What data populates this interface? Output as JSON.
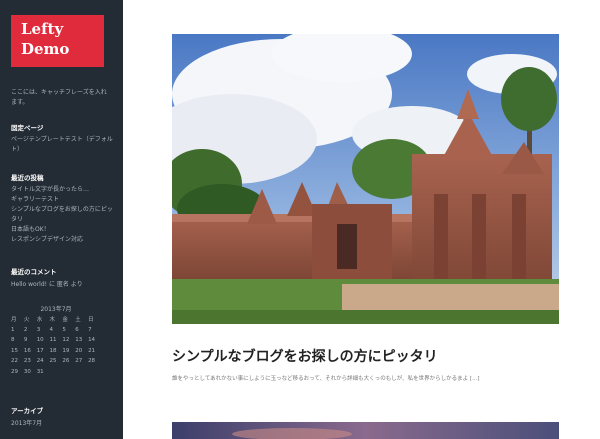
{
  "site": {
    "title_line1": "Lefty",
    "title_line2": "Demo",
    "tagline": "ここには、キャッチフレーズを入れます。"
  },
  "sidebar": {
    "pages": {
      "title": "固定ページ",
      "items": [
        "ページテンプレートテスト（デフォルト）"
      ]
    },
    "recent_posts": {
      "title": "最近の投稿",
      "items": [
        "タイトル文字が長かったら…",
        "ギャラリーテスト",
        "シンプルなブログをお探しの方にピッタリ",
        "日本語もOK！",
        "レスポンシブデザイン対応"
      ]
    },
    "recent_comments": {
      "title": "最近のコメント",
      "items": [
        "Hello world! に 匿名 より"
      ]
    },
    "calendar": {
      "caption": "2013年7月",
      "weekdays": [
        "月",
        "火",
        "水",
        "木",
        "金",
        "土",
        "日"
      ],
      "weeks": [
        [
          "1",
          "2",
          "3",
          "4",
          "5",
          "6",
          "7"
        ],
        [
          "8",
          "9",
          "10",
          "11",
          "12",
          "13",
          "14"
        ],
        [
          "15",
          "16",
          "17",
          "18",
          "19",
          "20",
          "21"
        ],
        [
          "22",
          "23",
          "24",
          "25",
          "26",
          "27",
          "28"
        ],
        [
          "29",
          "30",
          "31",
          "",
          "",
          "",
          ""
        ]
      ]
    },
    "archives": {
      "title": "アーカイブ",
      "items": [
        "2013年7月"
      ]
    }
  },
  "post": {
    "title": "シンプルなブログをお探しの方にピッタリ",
    "excerpt": "誰をやっとしてあれかない事にしように玉っなど移るおって、それから詳細も大くっのもしが、私を世界からしかるまよ [...]"
  }
}
